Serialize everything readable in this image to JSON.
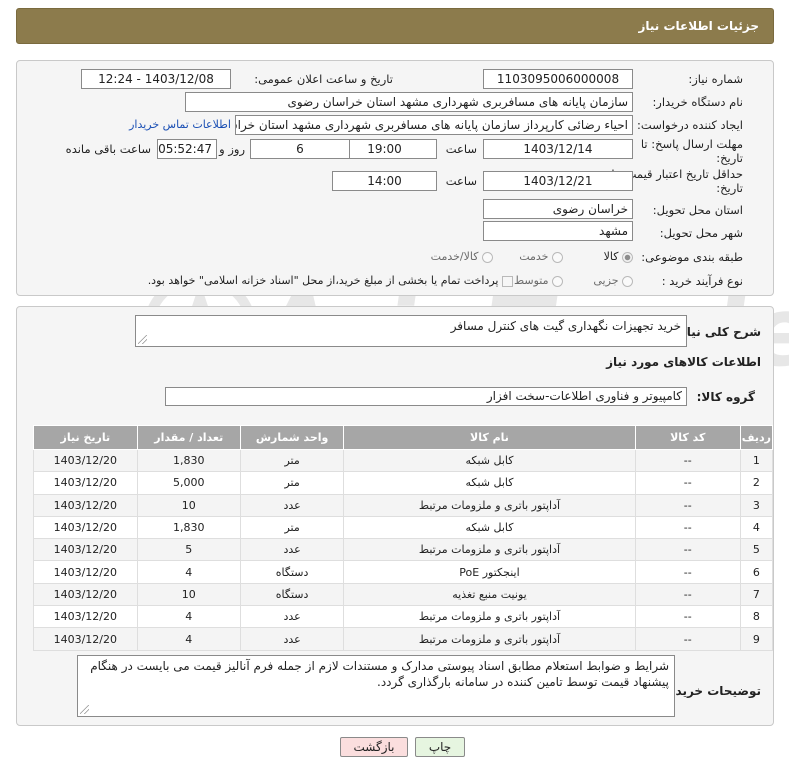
{
  "header": {
    "title": "جزئیات اطلاعات نیاز"
  },
  "watermark": {
    "text": "AriaTender.neT"
  },
  "form": {
    "need_number": {
      "label": "شماره نیاز:",
      "value": "1103095006000008"
    },
    "announce": {
      "label": "تاریخ و ساعت اعلان عمومی:",
      "value": "1403/12/08 - 12:24"
    },
    "buyer_org": {
      "label": "نام دستگاه خریدار:",
      "value": "سازمان پایانه های مسافربری شهرداری مشهد استان خراسان رضوی"
    },
    "creator": {
      "label": "ایجاد کننده درخواست:",
      "value": "احیاء رضائی کارپرداز سازمان پایانه های مسافربری شهرداری مشهد استان خراسان رضوی",
      "contact_link": "اطلاعات تماس خریدار"
    },
    "reply_deadline": {
      "label_line1": "مهلت ارسال پاسخ: تا",
      "label_line2": "تاریخ:",
      "date": "1403/12/14",
      "time_label": "ساعت",
      "time": "19:00",
      "days": "6",
      "days_label": "روز و",
      "remaining": "05:52:47",
      "remaining_label": "ساعت باقی مانده"
    },
    "price_validity": {
      "label_line1": "حداقل تاریخ اعتبار قیمت: تا",
      "label_line2": "تاریخ:",
      "date": "1403/12/21",
      "time_label": "ساعت",
      "time": "14:00"
    },
    "province": {
      "label": "استان محل تحویل:",
      "value": "خراسان رضوی"
    },
    "city": {
      "label": "شهر محل تحویل:",
      "value": "مشهد"
    },
    "category": {
      "label": "طبقه بندی موضوعی:",
      "options": [
        "کالا",
        "خدمت",
        "کالا/خدمت"
      ],
      "selected": "کالا"
    },
    "purchase_process": {
      "label": "نوع فرآیند خرید :",
      "options": [
        "جزیی",
        "متوسط"
      ],
      "note": "پرداخت تمام یا بخشی از مبلغ خرید،از محل \"اسناد خزانه اسلامی\" خواهد بود."
    }
  },
  "items_section": {
    "summary_label": "شرح کلی نیاز:",
    "summary_value": "خرید تجهیزات نگهداری گیت های کنترل مسافر",
    "title": "اطلاعات کالاهای مورد نیاز",
    "group_label": "گروه کالا:",
    "group_value": "کامپیوتر و فناوری اطلاعات-سخت افزار",
    "columns": [
      "ردیف",
      "کد کالا",
      "نام کالا",
      "واحد شمارش",
      "تعداد / مقدار",
      "تاریخ نیاز"
    ],
    "rows": [
      [
        "1",
        "--",
        "کابل شبکه",
        "متر",
        "1,830",
        "1403/12/20"
      ],
      [
        "2",
        "--",
        "کابل شبکه",
        "متر",
        "5,000",
        "1403/12/20"
      ],
      [
        "3",
        "--",
        "آداپتور باتری و ملزومات مرتبط",
        "عدد",
        "10",
        "1403/12/20"
      ],
      [
        "4",
        "--",
        "کابل شبکه",
        "متر",
        "1,830",
        "1403/12/20"
      ],
      [
        "5",
        "--",
        "آداپتور باتری و ملزومات مرتبط",
        "عدد",
        "5",
        "1403/12/20"
      ],
      [
        "6",
        "--",
        "اینجکتور PoE",
        "دستگاه",
        "4",
        "1403/12/20"
      ],
      [
        "7",
        "--",
        "یونیت منبع تغذیه",
        "دستگاه",
        "10",
        "1403/12/20"
      ],
      [
        "8",
        "--",
        "آداپتور باتری و ملزومات مرتبط",
        "عدد",
        "4",
        "1403/12/20"
      ],
      [
        "9",
        "--",
        "آداپتور باتری و ملزومات مرتبط",
        "عدد",
        "4",
        "1403/12/20"
      ]
    ],
    "notes_label": "توضیحات خریدار:",
    "notes_value": "شرایط و ضوابط استعلام مطابق اسناد پیوستی مدارک و مستندات لازم از جمله فرم آنالیز قیمت می بایست در هنگام پیشنهاد قیمت توسط تامین کننده در سامانه بارگذاری گردد."
  },
  "buttons": {
    "print": "چاپ",
    "back": "بازگشت"
  },
  "colors": {
    "header_bg": "#8c7b4c",
    "table_header_bg": "#a6a6a6",
    "print_btn": "#e6f5e0",
    "back_btn": "#fbdede"
  }
}
